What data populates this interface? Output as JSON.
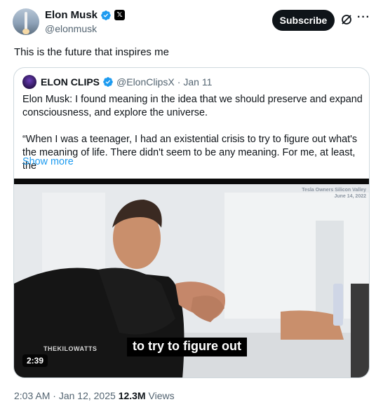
{
  "author": {
    "name": "Elon Musk",
    "handle": "@elonmusk",
    "verified_color": "#1d9bf0"
  },
  "actions": {
    "subscribe_label": "Subscribe",
    "grok_icon": "grok-icon",
    "more_icon": "more-icon"
  },
  "tweet": {
    "text": "This is the future that inspires me"
  },
  "quote": {
    "name": "ELON CLIPS",
    "handle": "@ElonClipsX",
    "separator": "·",
    "date": "Jan 11",
    "paragraph1": "Elon Musk: I found meaning in the idea that we should preserve and expand consciousness, and explore the universe.",
    "paragraph2": "“When I was a teenager, I had an existential crisis to try to figure out what's the meaning of life. There didn't seem to be any meaning. For me, at least, the",
    "show_more": "Show more"
  },
  "video": {
    "watermark_line1": "Tesla Owners Silicon Valley",
    "watermark_line2": "June 14, 2022",
    "watermark_left": "THEKILOWATTS",
    "caption": "to try to figure out",
    "duration": "2:39"
  },
  "meta": {
    "time": "2:03 AM",
    "separator": "·",
    "date": "Jan 12, 2025",
    "views_count": "12.3M",
    "views_label": "Views"
  },
  "colors": {
    "accent": "#1d9bf0",
    "text_primary": "#0f1419",
    "text_secondary": "#536471",
    "border": "#cfd9de"
  }
}
